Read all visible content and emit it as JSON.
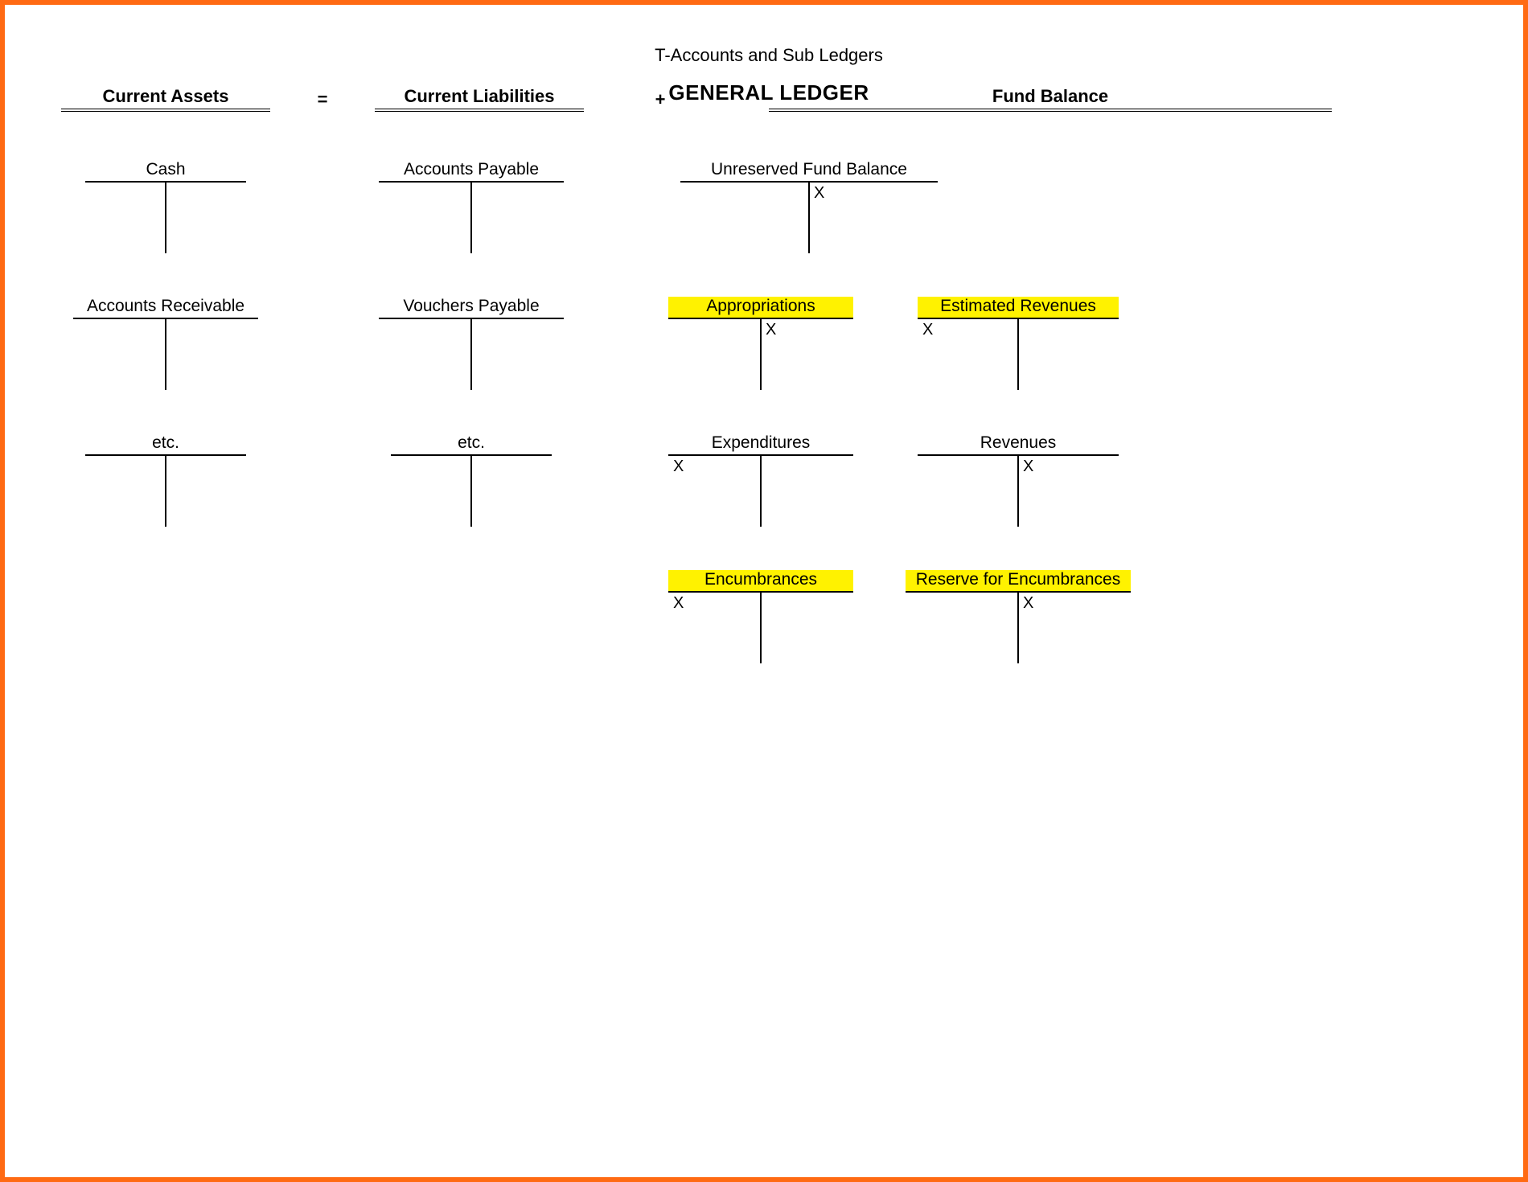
{
  "title": "T-Accounts and Sub Ledgers",
  "main_heading": "GENERAL LEDGER",
  "equation": {
    "assets": "Current Assets",
    "equals": "=",
    "liabilities": "Current Liabilities",
    "plus": "+",
    "fund": "Fund Balance"
  },
  "x_mark": "X",
  "accounts": {
    "cash": "Cash",
    "ar": "Accounts Receivable",
    "etc1": "etc.",
    "ap": "Accounts Payable",
    "vp": "Vouchers Payable",
    "etc2": "etc.",
    "ufb": "Unreserved Fund Balance",
    "approp": "Appropriations",
    "estrev": "Estimated Revenues",
    "expend": "Expenditures",
    "rev": "Revenues",
    "encum": "Encumbrances",
    "resenc": "Reserve for Encumbrances"
  }
}
